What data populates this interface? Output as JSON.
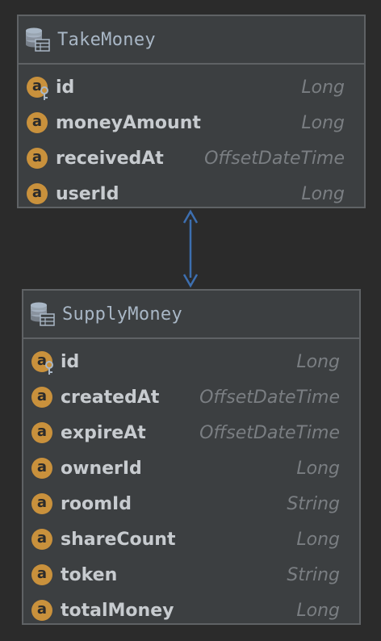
{
  "entities": [
    {
      "name": "TakeMoney",
      "fields": [
        {
          "name": "id",
          "type": "Long",
          "primary_key": true
        },
        {
          "name": "moneyAmount",
          "type": "Long",
          "primary_key": false
        },
        {
          "name": "receivedAt",
          "type": "OffsetDateTime",
          "primary_key": false
        },
        {
          "name": "userId",
          "type": "Long",
          "primary_key": false
        }
      ]
    },
    {
      "name": "SupplyMoney",
      "fields": [
        {
          "name": "id",
          "type": "Long",
          "primary_key": true
        },
        {
          "name": "createdAt",
          "type": "OffsetDateTime",
          "primary_key": false
        },
        {
          "name": "expireAt",
          "type": "OffsetDateTime",
          "primary_key": false
        },
        {
          "name": "ownerId",
          "type": "Long",
          "primary_key": false
        },
        {
          "name": "roomId",
          "type": "String",
          "primary_key": false
        },
        {
          "name": "shareCount",
          "type": "Long",
          "primary_key": false
        },
        {
          "name": "token",
          "type": "String",
          "primary_key": false
        },
        {
          "name": "totalMoney",
          "type": "Long",
          "primary_key": false
        }
      ]
    }
  ],
  "field_icon_letter": "a",
  "relation": {
    "type": "bidirectional",
    "color": "#3d6fb0"
  },
  "colors": {
    "background": "#2b2b2b",
    "entity_fill": "#3c3f41",
    "entity_border": "#5f6265",
    "field_icon": "#c9913c"
  },
  "icons": {
    "entity": "table-icon",
    "field": "field-icon",
    "primary_key": "key-icon"
  }
}
